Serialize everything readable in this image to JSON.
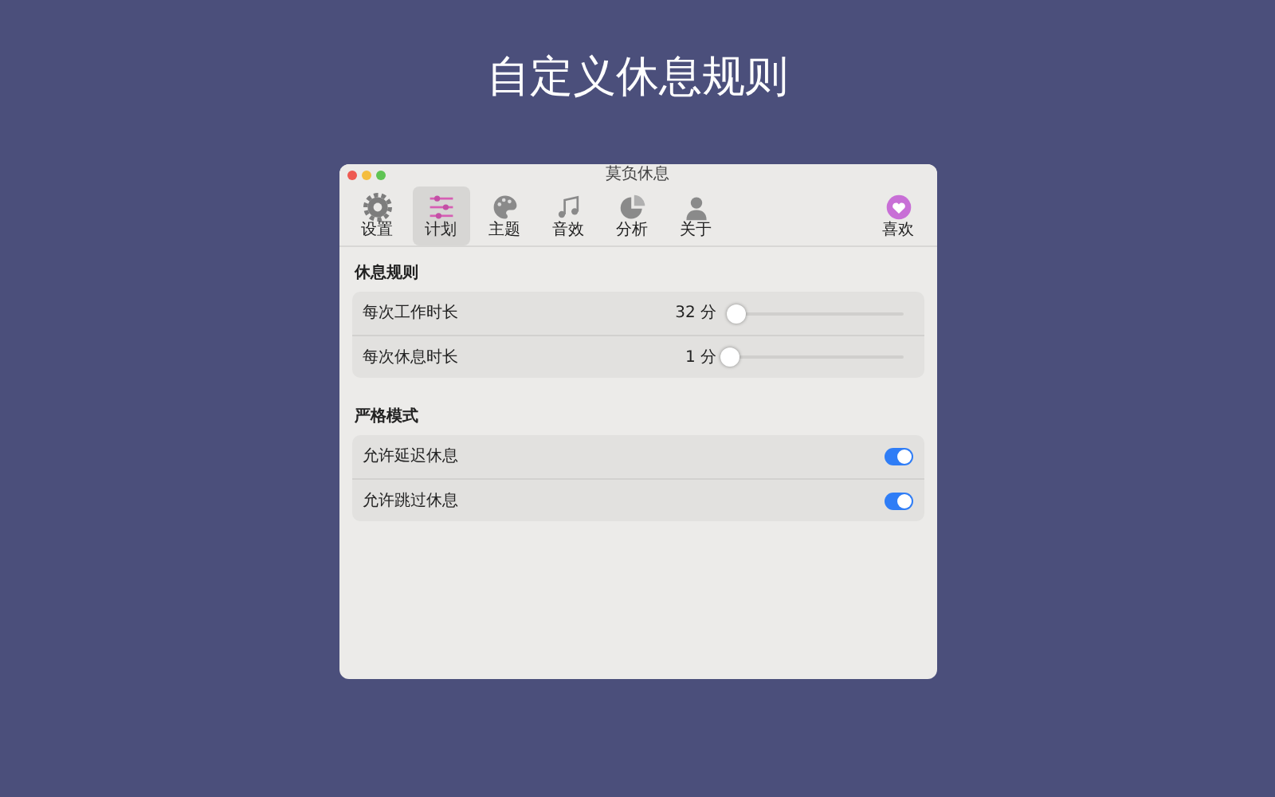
{
  "heading": "自定义休息规则",
  "window": {
    "title": "莫负休息"
  },
  "toolbar": {
    "items": [
      {
        "label": "设置",
        "selected": false
      },
      {
        "label": "计划",
        "selected": true
      },
      {
        "label": "主题",
        "selected": false
      },
      {
        "label": "音效",
        "selected": false
      },
      {
        "label": "分析",
        "selected": false
      },
      {
        "label": "关于",
        "selected": false
      }
    ],
    "end_item": {
      "label": "喜欢",
      "selected": false
    }
  },
  "sections": [
    {
      "title": "休息规则",
      "rows": [
        {
          "kind": "slider",
          "label": "每次工作时长",
          "reading": "32 分",
          "level": 0.04
        },
        {
          "kind": "slider",
          "label": "每次休息时长",
          "reading": "1 分",
          "level": 0
        }
      ]
    },
    {
      "title": "严格模式",
      "rows": [
        {
          "kind": "switch",
          "label": "允许延迟休息",
          "on": true
        },
        {
          "kind": "switch",
          "label": "允许跳过休息",
          "on": true
        }
      ]
    }
  ]
}
